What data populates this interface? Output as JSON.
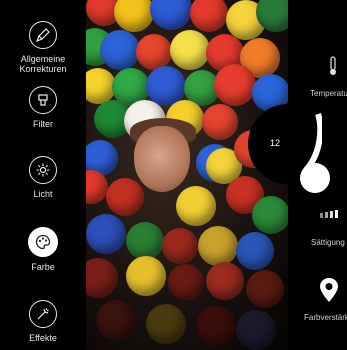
{
  "sidebar": {
    "tools": [
      {
        "label": "Allgemeine\nKorrekturen",
        "icon": "brush-icon"
      },
      {
        "label": "Filter",
        "icon": "filter-icon"
      },
      {
        "label": "Licht",
        "icon": "sun-icon"
      },
      {
        "label": "Farbe",
        "icon": "palette-icon",
        "active": true
      },
      {
        "label": "Effekte",
        "icon": "effects-icon"
      }
    ]
  },
  "adjustments": {
    "temperature_label": "Temperatu",
    "saturation_label": "Sättigung",
    "color_boost_label": "Farbverstärk",
    "wheel_value": "12"
  },
  "colors": {
    "background": "#000000",
    "accent": "#ffffff"
  }
}
